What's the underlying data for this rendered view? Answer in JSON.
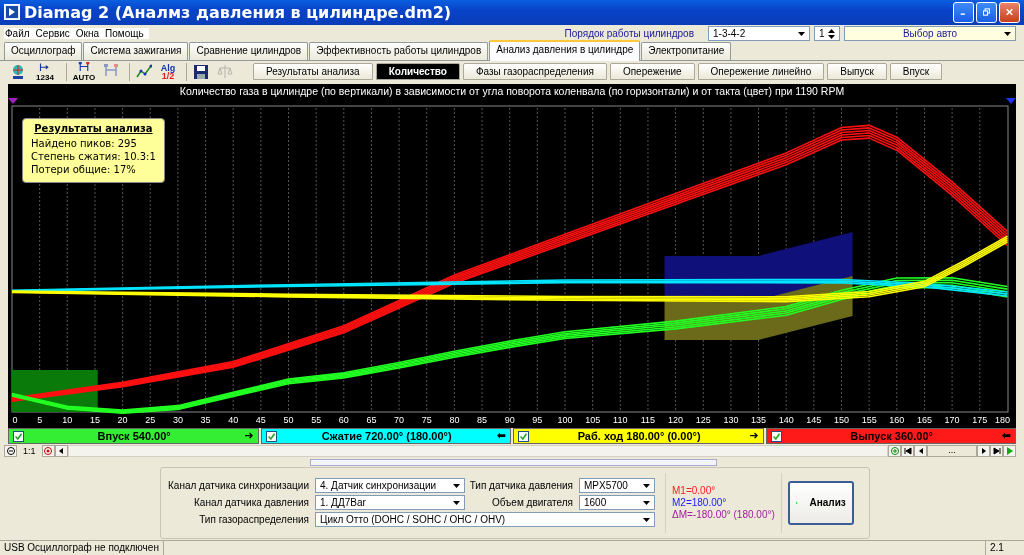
{
  "window": {
    "title": "Diamag 2 (Аналмз давления в цилиндре.dm2)"
  },
  "menu": [
    "Файл",
    "Сервис",
    "Окна",
    "Помощь"
  ],
  "cylinder_order": {
    "label": "Порядок работы цилиндров",
    "value": "1-3-4-2",
    "cylinder": "1",
    "car_select": "Выбор авто"
  },
  "tabs": [
    {
      "label": "Осциллограф",
      "selected": false
    },
    {
      "label": "Система зажигания",
      "selected": false
    },
    {
      "label": "Сравнение цилиндров",
      "selected": false
    },
    {
      "label": "Эффективность работы цилиндров",
      "selected": false
    },
    {
      "label": "Анализ давления в цилиндре",
      "selected": true
    },
    {
      "label": "Электропитание",
      "selected": false
    }
  ],
  "toolbar": [
    {
      "kind": "network",
      "disabled": false
    },
    {
      "kind": "marker",
      "caption": "1234",
      "disabled": false
    },
    {
      "kind": "markers",
      "caption": "AUTO",
      "disabled": false
    },
    {
      "kind": "markers",
      "disabled": true
    },
    {
      "kind": "graph",
      "disabled": false
    },
    {
      "kind": "alg",
      "caption": "Alg",
      "sub": "1/2",
      "disabled": false
    },
    {
      "kind": "save",
      "disabled": false
    },
    {
      "kind": "scales",
      "disabled": true
    }
  ],
  "view_tabs": [
    {
      "label": "Результаты анализа",
      "selected": false
    },
    {
      "label": "Количество",
      "selected": true
    },
    {
      "label": "Фазы газораспределения",
      "selected": false
    },
    {
      "label": "Опережение",
      "selected": false
    },
    {
      "label": "Опережение линейно",
      "selected": false
    },
    {
      "label": "Выпуск",
      "selected": false
    },
    {
      "label": "Впуск",
      "selected": false
    }
  ],
  "chart": {
    "title": "Количество газа в цилиндре (по вертикали) в зависимости от угла поворота коленвала (по горизонтали) и от такта (цвет) при 1190 RPM",
    "x_labels": [
      "0",
      "5",
      "10",
      "15",
      "20",
      "25",
      "30",
      "35",
      "40",
      "45",
      "50",
      "55",
      "60",
      "65",
      "70",
      "75",
      "80",
      "85",
      "90",
      "95",
      "100",
      "105",
      "110",
      "115",
      "120",
      "125",
      "130",
      "135",
      "140",
      "145",
      "150",
      "155",
      "160",
      "165",
      "170",
      "175",
      "180"
    ],
    "info": {
      "title": "Результаты анализа",
      "lines": [
        "Найдено пиков: 295",
        "Степень сжатия: 10.3:1",
        "Потери общие: 17%"
      ]
    }
  },
  "phases": [
    {
      "label": "Впуск 540.00°",
      "color": "#33ee33",
      "checked": true,
      "arrow": "➜"
    },
    {
      "label": "Сжатие 720.00° (180.00°)",
      "color": "#00ffff",
      "checked": true,
      "arrow": "⬅"
    },
    {
      "label": "Раб. ход 180.00° (0.00°)",
      "color": "#ffff00",
      "checked": true,
      "arrow": "➜"
    },
    {
      "label": "Выпуск 360.00°",
      "color": "#ff1a1a",
      "checked": true,
      "arrow": "⬅"
    }
  ],
  "scroll_bar": {
    "scale": "1:1",
    "page": "..."
  },
  "settings": {
    "fields": [
      {
        "label": "Канал датчика синхронизации",
        "value": "4.  Датчик синхронизации"
      },
      {
        "label": "Тип датчика давления",
        "value": "MPX5700"
      },
      {
        "label": "Канал датчика давления",
        "value": "1.  ДД7Bar"
      },
      {
        "label": "Объем двигателя",
        "value": "1600"
      },
      {
        "label": "Тип газораспределения",
        "value": "Цикл Отто (DOHC / SOHC / OHC / OHV)"
      }
    ],
    "markers": [
      {
        "text": "M1=0.00°",
        "color": "#ff2020"
      },
      {
        "text": "M2=180.00°",
        "color": "#2020ff"
      },
      {
        "text": "ΔM=-180.00° (180.00°)",
        "color": "#a020a0"
      }
    ],
    "button": "Анализ"
  },
  "status_bar": {
    "connection": "USB Осциллограф не подключен",
    "version": "2.1"
  }
}
